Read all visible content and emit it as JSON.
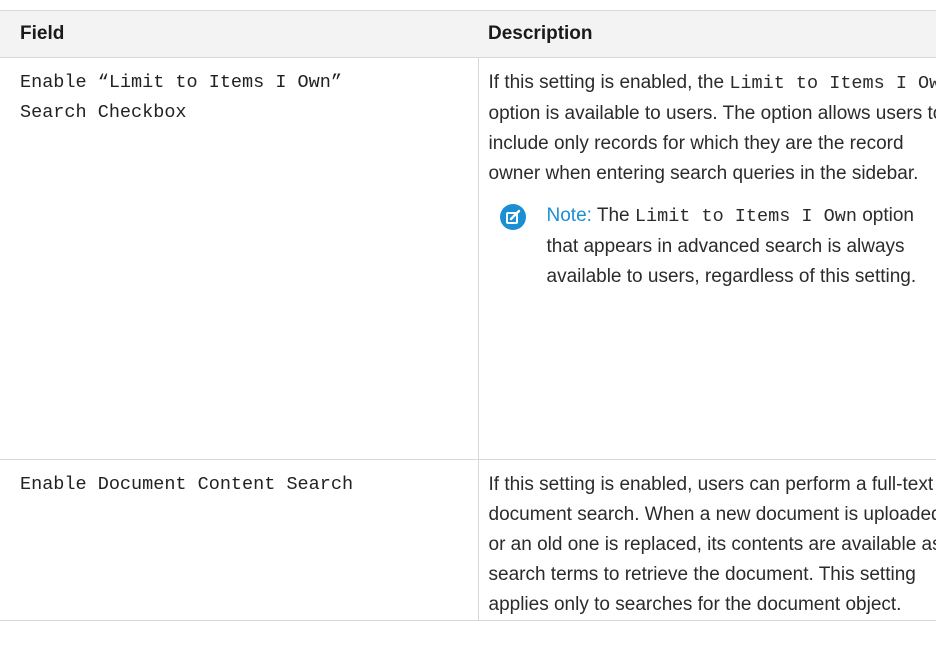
{
  "table": {
    "headers": {
      "field": "Field",
      "description": "Description"
    },
    "rows": [
      {
        "field_line1": "Enable “Limit to Items I Own”",
        "field_line2": "Search Checkbox",
        "desc_text1": "If this setting is enabled, the ",
        "desc_code1": "Limit to Items I Own",
        "desc_text2": " option is available to users. The option allows users to include only records for which they are the record owner when entering search queries in the sidebar.",
        "note": {
          "icon": "edit-note-icon",
          "label": "Note:",
          "text1": " The ",
          "code": "Limit to Items I Own",
          "text2": " option that appears in advanced search is always available to users, regardless of this setting."
        }
      },
      {
        "field": "Enable Document Content Search",
        "desc": "If this setting is enabled, users can perform a full-text document search. When a new document is uploaded or an old one is replaced, its contents are available as search terms to retrieve the document. This setting applies only to searches for the document object."
      }
    ]
  },
  "colors": {
    "note_accent": "#1b8fd4",
    "header_bg": "#f3f3f3",
    "border": "#d8d8d8"
  }
}
